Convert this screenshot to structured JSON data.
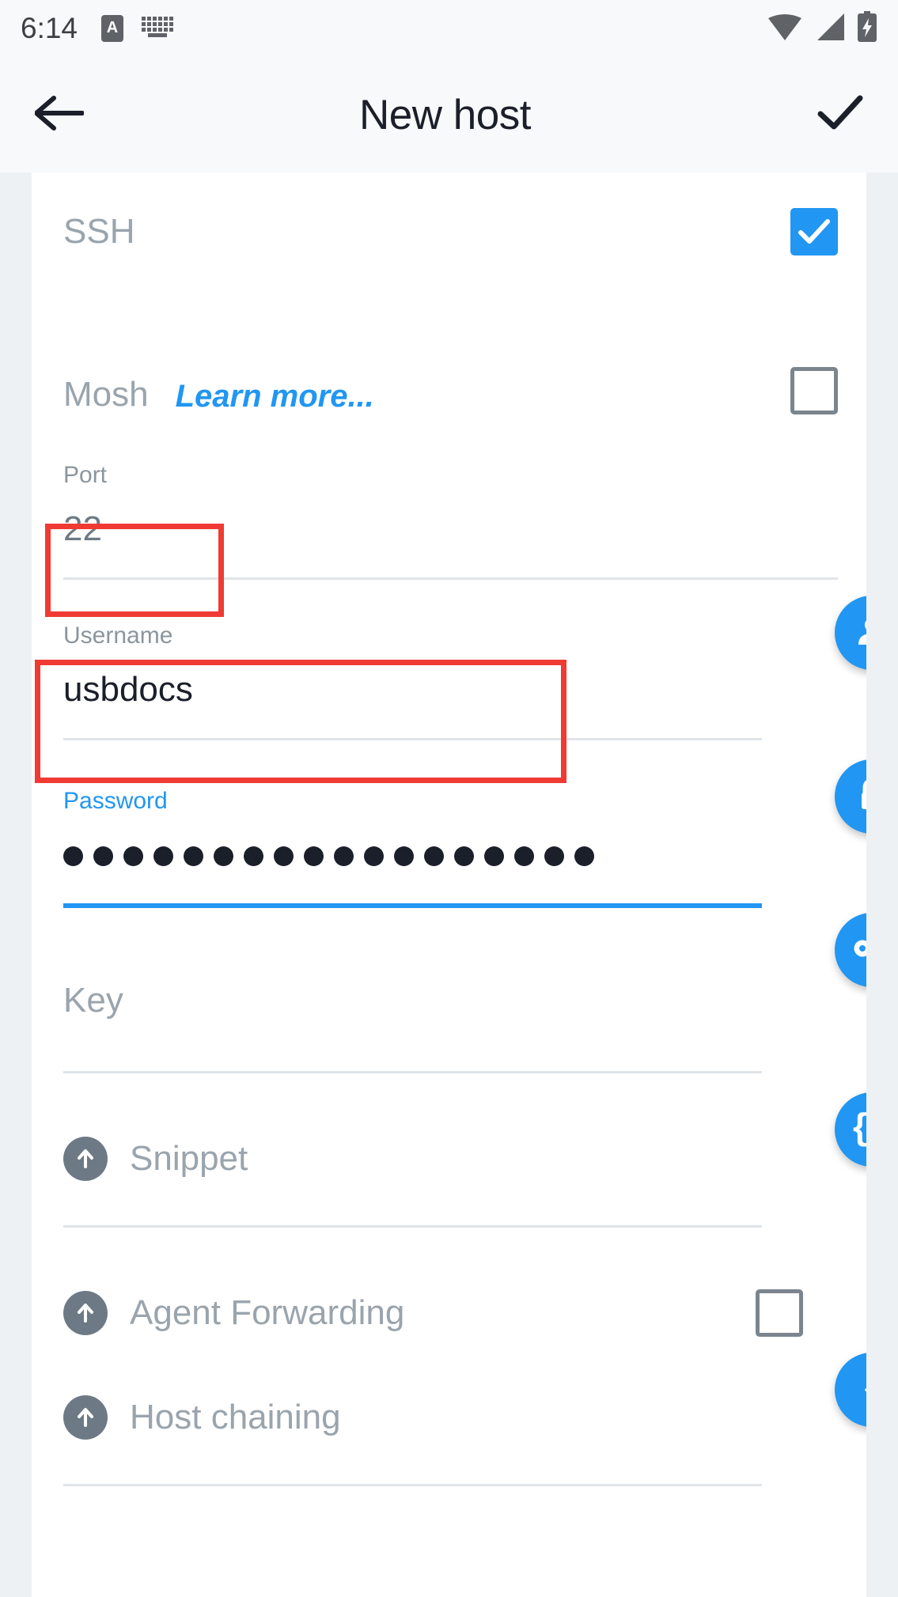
{
  "status_bar": {
    "time": "6:14",
    "left_icons": [
      "input-method-badge-icon",
      "keyboard-icon"
    ],
    "right_icons": [
      "wifi-icon",
      "cellular-signal-icon",
      "battery-charging-icon"
    ],
    "input_badge_letter": "A"
  },
  "app_bar": {
    "back_label": "←",
    "title": "New host",
    "save_label": "✓"
  },
  "form": {
    "ssh": {
      "label": "SSH",
      "checked": true
    },
    "mosh": {
      "label": "Mosh",
      "link_label": "Learn more...",
      "checked": false
    },
    "port": {
      "label": "Port",
      "value": "22"
    },
    "username": {
      "label": "Username",
      "value": "usbdocs",
      "action_icon": "person-icon",
      "highlighted": true
    },
    "password": {
      "label": "Password",
      "masked_value": "••••••••••••••••••",
      "dot_count": 18,
      "focused": true,
      "action_icon": "lock-icon",
      "highlighted": true
    },
    "key": {
      "label": "Key",
      "value": "",
      "action_icon": "key-icon"
    },
    "snippet": {
      "label": "Snippet",
      "value": "",
      "prefix_icon": "arrow-up-circle-icon",
      "action_icon": "curly-braces-icon",
      "action_glyph": "{}"
    },
    "agent_forwarding": {
      "label": "Agent Forwarding",
      "prefix_icon": "arrow-up-circle-icon",
      "checked": false
    },
    "host_chaining": {
      "label": "Host chaining",
      "prefix_icon": "arrow-up-circle-icon",
      "action_icon": "host-chaining-icon"
    }
  },
  "colors": {
    "accent": "#2196f3",
    "annotation": "#ef3b33",
    "label_muted": "#9aa4ad",
    "text_primary": "#1b1f2a",
    "divider": "#e3e7ea",
    "sheet_bg": "#ffffff",
    "page_bg": "#eef1f4",
    "bar_bg": "#f7f9fa"
  }
}
